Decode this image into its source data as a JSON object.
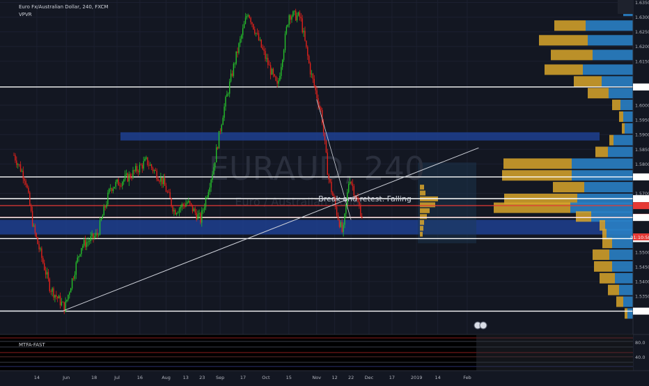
{
  "header": {
    "symbol_line": "Euro Fx/Australian Dollar, 240, FXCM",
    "indicator": "VPVR",
    "watermark_big": "EURAUD, 240",
    "watermark_small": "Euro / Australian Dollar"
  },
  "annotation": {
    "text": "Break and retest. Falling"
  },
  "countdown": "01:10:58",
  "colors": {
    "background": "#131722",
    "bull": "#26c22b",
    "bear": "#e3221b",
    "vp_gold": "#d9a62a",
    "vp_blue": "#2a7fc4",
    "zone_blue": "#1f3f8f",
    "level_white": "#ffffff",
    "level_red": "#e53935"
  },
  "chart_data": {
    "type": "candlestick",
    "title": "Euro Fx/Australian Dollar, 240, FXCM",
    "ylim": [
      1.5235,
      1.635
    ],
    "price_ticks": [
      "1.63500",
      "1.63000",
      "1.62500",
      "1.62000",
      "1.61500",
      "1.60622",
      "1.60000",
      "1.59500",
      "1.59000",
      "1.58500",
      "1.58000",
      "1.57561",
      "1.57000",
      "1.56820",
      "1.56583",
      "1.56186",
      "1.56179",
      "1.55460",
      "1.55000",
      "1.54500",
      "1.54000",
      "1.53500",
      "1.52991"
    ],
    "x_ticks": [
      "14",
      "Jun",
      "18",
      "Jul",
      "16",
      "Aug",
      "13",
      "23",
      "Sep",
      "17",
      "Oct",
      "15",
      "Nov",
      "12",
      "22",
      "Dec",
      "17",
      "2019",
      "14",
      "Feb"
    ],
    "price_path": [
      {
        "t": "Apr 30",
        "p": 1.583
      },
      {
        "t": "May 7",
        "p": 1.575
      },
      {
        "t": "May 12",
        "p": 1.558
      },
      {
        "t": "May 22",
        "p": 1.538
      },
      {
        "t": "May 31",
        "p": 1.531
      },
      {
        "t": "Jun 10",
        "p": 1.552
      },
      {
        "t": "Jun 20",
        "p": 1.556
      },
      {
        "t": "Jun 28",
        "p": 1.572
      },
      {
        "t": "Jul 10",
        "p": 1.576
      },
      {
        "t": "Jul 20",
        "p": 1.581
      },
      {
        "t": "Jul 30",
        "p": 1.574
      },
      {
        "t": "Aug 6",
        "p": 1.564
      },
      {
        "t": "Aug 14",
        "p": 1.567
      },
      {
        "t": "Aug 22",
        "p": 1.561
      },
      {
        "t": "Aug 30",
        "p": 1.579
      },
      {
        "t": "Sep 5",
        "p": 1.598
      },
      {
        "t": "Sep 12",
        "p": 1.615
      },
      {
        "t": "Sep 20",
        "p": 1.632
      },
      {
        "t": "Sep 28",
        "p": 1.62
      },
      {
        "t": "Oct 8",
        "p": 1.606
      },
      {
        "t": "Oct 15",
        "p": 1.631
      },
      {
        "t": "Oct 22",
        "p": 1.63
      },
      {
        "t": "Oct 28",
        "p": 1.612
      },
      {
        "t": "Nov 4",
        "p": 1.597
      },
      {
        "t": "Nov 8",
        "p": 1.576
      },
      {
        "t": "Nov 13",
        "p": 1.564
      },
      {
        "t": "Nov 17",
        "p": 1.556
      },
      {
        "t": "Nov 21",
        "p": 1.576
      },
      {
        "t": "Nov 26",
        "p": 1.567
      },
      {
        "t": "Nov 29",
        "p": 1.5618
      }
    ],
    "levels": [
      {
        "price": 1.60622,
        "color": "white",
        "label": "1.60622"
      },
      {
        "price": 1.57561,
        "color": "white",
        "label": "1.57561"
      },
      {
        "price": 1.5682,
        "color": "white",
        "label": "1.56820"
      },
      {
        "price": 1.56583,
        "color": "red",
        "label": "1.56583"
      },
      {
        "price": 1.56186,
        "color": "red",
        "label": "1.56186"
      },
      {
        "price": 1.56179,
        "color": "white",
        "label": "1.56179"
      },
      {
        "price": 1.5546,
        "color": "white",
        "label": "1.55460"
      },
      {
        "price": 1.52991,
        "color": "white",
        "label": "1.52991"
      }
    ],
    "zones": [
      {
        "from": 1.588,
        "to": 1.5908,
        "color": "blue"
      },
      {
        "from": 1.556,
        "to": 1.561,
        "color": "blue"
      }
    ],
    "trendline": {
      "from": {
        "t": "May 30",
        "p": 1.53
      },
      "to": {
        "t": "Feb 8",
        "p": 1.5855
      }
    },
    "volume_profile_note": "VPVR histogram on right side, gold = down volume, blue = up volume",
    "oscillator": {
      "name": "MTFA-FAST",
      "ticks": [
        "80.0",
        "40.0"
      ]
    }
  }
}
